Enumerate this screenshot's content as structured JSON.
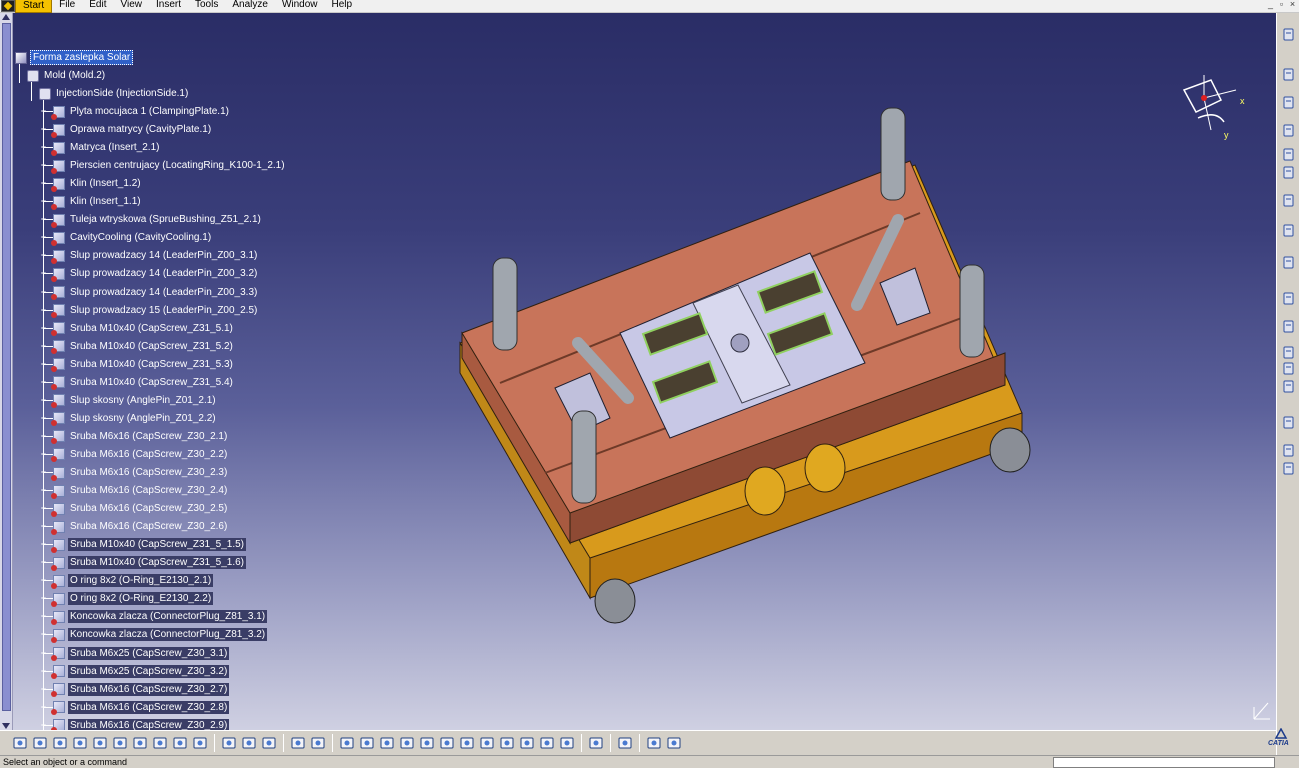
{
  "menu": {
    "items": [
      "Start",
      "File",
      "Edit",
      "View",
      "Insert",
      "Tools",
      "Analyze",
      "Window",
      "Help"
    ],
    "active": "Start"
  },
  "tree": {
    "root": "Forma zaslepka Solar",
    "mold": "Mold (Mold.2)",
    "injection_side": "InjectionSide (InjectionSide.1)",
    "items": [
      {
        "label": "Plyta mocujaca 1 (ClampingPlate.1)",
        "highlight": false
      },
      {
        "label": "Oprawa matrycy (CavityPlate.1)",
        "highlight": false
      },
      {
        "label": "Matryca (Insert_2.1)",
        "highlight": false
      },
      {
        "label": "Pierscien centrujacy (LocatingRing_K100-1_2.1)",
        "highlight": false
      },
      {
        "label": "Klin (Insert_1.2)",
        "highlight": false
      },
      {
        "label": "Klin (Insert_1.1)",
        "highlight": false
      },
      {
        "label": "Tuleja wtryskowa (SprueBushing_Z51_2.1)",
        "highlight": false
      },
      {
        "label": "CavityCooling (CavityCooling.1)",
        "highlight": false
      },
      {
        "label": "Slup prowadzacy 14 (LeaderPin_Z00_3.1)",
        "highlight": false
      },
      {
        "label": "Slup prowadzacy 14 (LeaderPin_Z00_3.2)",
        "highlight": false
      },
      {
        "label": "Slup prowadzacy 14 (LeaderPin_Z00_3.3)",
        "highlight": false
      },
      {
        "label": "Slup prowadzacy 15 (LeaderPin_Z00_2.5)",
        "highlight": false
      },
      {
        "label": "Sruba M10x40 (CapScrew_Z31_5.1)",
        "highlight": false
      },
      {
        "label": "Sruba M10x40 (CapScrew_Z31_5.2)",
        "highlight": false
      },
      {
        "label": "Sruba M10x40 (CapScrew_Z31_5.3)",
        "highlight": false
      },
      {
        "label": "Sruba M10x40 (CapScrew_Z31_5.4)",
        "highlight": false
      },
      {
        "label": "Slup skosny (AnglePin_Z01_2.1)",
        "highlight": false
      },
      {
        "label": "Slup skosny (AnglePin_Z01_2.2)",
        "highlight": false
      },
      {
        "label": "Sruba M6x16 (CapScrew_Z30_2.1)",
        "highlight": false
      },
      {
        "label": "Sruba M6x16 (CapScrew_Z30_2.2)",
        "highlight": false
      },
      {
        "label": "Sruba M6x16 (CapScrew_Z30_2.3)",
        "highlight": false
      },
      {
        "label": "Sruba M6x16 (CapScrew_Z30_2.4)",
        "highlight": false
      },
      {
        "label": "Sruba M6x16 (CapScrew_Z30_2.5)",
        "highlight": false
      },
      {
        "label": "Sruba M6x16 (CapScrew_Z30_2.6)",
        "highlight": false
      },
      {
        "label": "Sruba M10x40 (CapScrew_Z31_5_1.5)",
        "highlight": true
      },
      {
        "label": "Sruba M10x40 (CapScrew_Z31_5_1.6)",
        "highlight": true
      },
      {
        "label": "O ring 8x2 (O-Ring_E2130_2.1)",
        "highlight": true
      },
      {
        "label": "O ring 8x2 (O-Ring_E2130_2.2)",
        "highlight": true
      },
      {
        "label": "Koncowka zlacza (ConnectorPlug_Z81_3.1)",
        "highlight": true
      },
      {
        "label": "Koncowka zlacza (ConnectorPlug_Z81_3.2)",
        "highlight": true
      },
      {
        "label": "Sruba M6x25 (CapScrew_Z30_3.1)",
        "highlight": true
      },
      {
        "label": "Sruba M6x25 (CapScrew_Z30_3.2)",
        "highlight": true
      },
      {
        "label": "Sruba M6x16 (CapScrew_Z30_2.7)",
        "highlight": true
      },
      {
        "label": "Sruba M6x16 (CapScrew_Z30_2.8)",
        "highlight": true
      },
      {
        "label": "Sruba M6x16 (CapScrew_Z30_2.9)",
        "highlight": true
      }
    ]
  },
  "compass": {
    "x_label": "x",
    "y_label": "y"
  },
  "status": {
    "message": "Select an object or a command"
  },
  "logo": {
    "text": "CATIA"
  },
  "colors": {
    "plate": "#c8745a",
    "base": "#d89a1c",
    "insert": "#c8c8e6",
    "pin": "#a0a6ae",
    "background_top": "#2a2d66",
    "background_bottom": "#cfd0e2",
    "selection": "#3060c8"
  }
}
